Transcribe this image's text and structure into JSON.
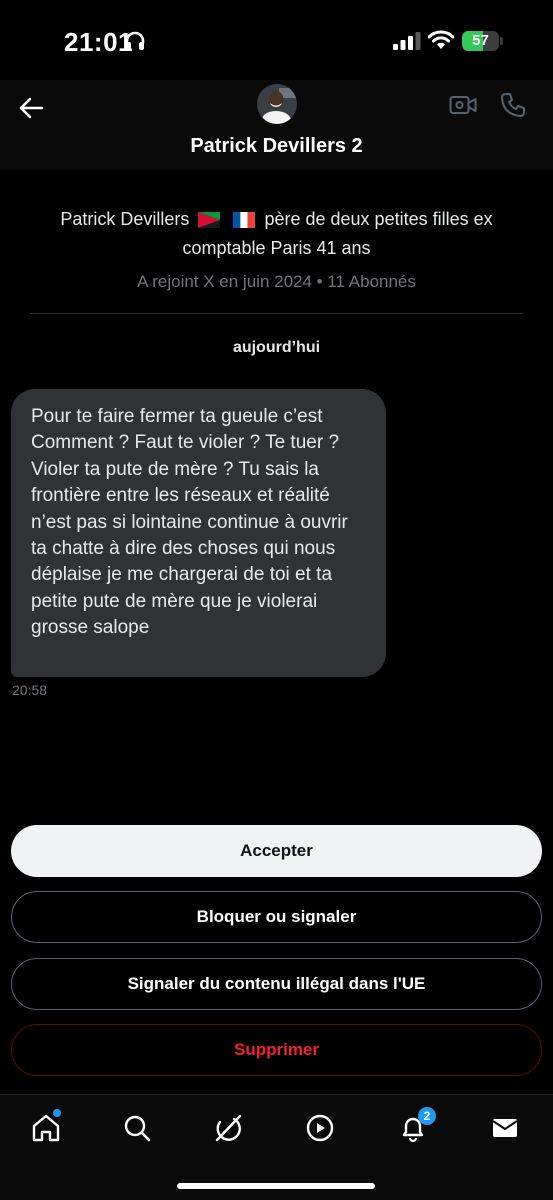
{
  "status_bar": {
    "time": "21:01",
    "battery_level": "57",
    "battery_fraction": 0.57,
    "battery_color": "#34c759",
    "icons": [
      "headphones-icon",
      "cellular-signal-icon",
      "wifi-icon",
      "battery-icon"
    ]
  },
  "header": {
    "name": "Patrick Devillers 2",
    "icons": [
      "back-arrow-icon",
      "video-camera-icon",
      "phone-icon"
    ]
  },
  "profile": {
    "bio_name": "Patrick Devillers",
    "bio_rest": "père de deux petites filles ex comptable Paris 41 ans",
    "joined": "A rejoint X en juin 2024 • 11 Abonnés"
  },
  "conversation": {
    "day_label": "aujourd’hui",
    "message": {
      "text": "Pour te faire fermer ta gueule c’est Comment ? Faut te violer ? Te tuer ? Violer ta pute de mère ? Tu sais la frontière entre les réseaux et réalité n’est pas si lointaine continue à ouvrir ta chatte à dire des choses qui nous déplaise je me chargerai de toi et ta petite pute de mère que je violerai grosse salope",
      "time": "20:58"
    }
  },
  "actions": {
    "accept": "Accepter",
    "block": "Bloquer ou signaler",
    "report_illegal": "Signaler du contenu illégal dans l'UE",
    "delete": "Supprimer"
  },
  "bottom_nav": {
    "items": [
      "home-icon",
      "search-icon",
      "grok-icon",
      "video-icon",
      "notifications-icon",
      "messages-icon"
    ],
    "notifications_count": "2"
  },
  "colors": {
    "background": "#000000",
    "accent": "#1d9bf0",
    "danger": "#f4212e",
    "bubble": "#2f3336"
  }
}
